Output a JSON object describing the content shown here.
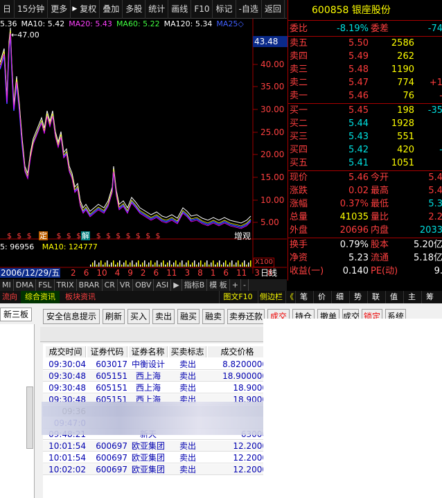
{
  "toolbar": {
    "items": [
      "日",
      "15分钟",
      "更多",
      "复权",
      "叠加",
      "多股",
      "统计",
      "画线",
      "F10",
      "标记",
      "-自选",
      "返回"
    ],
    "arrow": "▶"
  },
  "ma": {
    "first": "5.36",
    "ma10": "MA10: 5.42",
    "ma20": "MA20: 5.43",
    "ma60": "MA60: 5.22",
    "ma120": "MA120: 5.34",
    "ma250": "MA25◇"
  },
  "chart": {
    "peak_label": "47.00",
    "price_box": "43.48",
    "yticks": [
      "40.00",
      "35.00",
      "30.00",
      "25.00",
      "20.00",
      "15.00",
      "10.00",
      "5.00"
    ],
    "mid_labels": [
      "增",
      "观"
    ],
    "vol_label": "5: 96956",
    "vol_ma": "MA10: 124777",
    "x100": "X100",
    "date_label": "2006/12/29/五",
    "date_ticks": [
      "2",
      "6",
      "10",
      "4",
      "9",
      "2",
      "6",
      "11",
      "3",
      "8",
      "1",
      "6",
      "11",
      "3",
      "8"
    ],
    "dayline": "日线",
    "sig_marks": [
      "$",
      "$",
      "$",
      "$",
      "$",
      "$",
      "$",
      "$",
      "$",
      "$",
      "$",
      "$",
      "$",
      "$",
      "$",
      "$"
    ],
    "sig_special": [
      "定",
      "解"
    ]
  },
  "stock": {
    "code": "600858",
    "name": "银座股份"
  },
  "quote": {
    "weibi_label": "委比",
    "weibi": "-8.19%",
    "weicha_label": "委差",
    "weicha": "-74",
    "asks": [
      {
        "label": "卖五",
        "price": "5.50",
        "vol": "2586",
        "chg": ""
      },
      {
        "label": "卖四",
        "price": "5.49",
        "vol": "262",
        "chg": ""
      },
      {
        "label": "卖三",
        "price": "5.48",
        "vol": "1190",
        "chg": ""
      },
      {
        "label": "卖二",
        "price": "5.47",
        "vol": "774",
        "chg": "+1"
      },
      {
        "label": "卖一",
        "price": "5.46",
        "vol": "76",
        "chg": "-"
      }
    ],
    "bids": [
      {
        "label": "买一",
        "price": "5.45",
        "vol": "198",
        "chg": "-35"
      },
      {
        "label": "买二",
        "price": "5.44",
        "vol": "1928",
        "chg": ""
      },
      {
        "label": "买三",
        "price": "5.43",
        "vol": "551",
        "chg": ""
      },
      {
        "label": "买四",
        "price": "5.42",
        "vol": "420",
        "chg": "-"
      },
      {
        "label": "买五",
        "price": "5.41",
        "vol": "1051",
        "chg": ""
      }
    ],
    "stats": [
      {
        "l1": "现价",
        "v1": "5.46",
        "l2": "今开",
        "v2": "5.4"
      },
      {
        "l1": "涨跌",
        "v1": "0.02",
        "l2": "最高",
        "v2": "5.4"
      },
      {
        "l1": "涨幅",
        "v1": "0.37%",
        "l2": "最低",
        "v2": "5.3"
      },
      {
        "l1": "总量",
        "v1": "41035",
        "l2": "量比",
        "v2": "2.2"
      },
      {
        "l1": "外盘",
        "v1": "20696",
        "l2": "内盘",
        "v2": "2033"
      }
    ],
    "extra": [
      {
        "l1": "换手",
        "v1": "0.79%",
        "l2": "股本",
        "v2": "5.20亿"
      },
      {
        "l1": "净资",
        "v1": "5.23",
        "l2": "流通",
        "v2": "5.18亿"
      },
      {
        "l1": "收益(一)",
        "v1": "0.140",
        "l2": "PE(动)",
        "v2": "9."
      }
    ]
  },
  "indtabs": [
    "MI",
    "DMA",
    "FSL",
    "TRIX",
    "BRAR",
    "CR",
    "VR",
    "OBV",
    "ASI",
    "▶",
    "指标B",
    "模 板",
    "+",
    "-"
  ],
  "subtabs": {
    "left": [
      "流向",
      "综合资讯",
      "板块资讯"
    ],
    "right": [
      "图文F10",
      "侧边栏",
      "《",
      "笔",
      "价",
      "细",
      "势",
      "联",
      "值",
      "主",
      "筹"
    ]
  },
  "lower": {
    "left_btn": "新三板",
    "buttons": [
      "安全信息提示",
      "刷新",
      "买入",
      "卖出",
      "融买",
      "融卖",
      "卖券还款",
      "成交",
      "持仓",
      "撤单",
      "成交",
      "锁定",
      "系统"
    ],
    "headers": [
      "成交时间",
      "证券代码",
      "证券名称",
      "买卖标志",
      "成交价格",
      "成交"
    ],
    "rows": [
      {
        "time": "09:30:04",
        "code": "603017",
        "name": "中衡设计",
        "flag": "卖出",
        "price": "8.8200000"
      },
      {
        "time": "09:30:48",
        "code": "605151",
        "name": "西上海",
        "flag": "卖出",
        "price": "18.900000"
      },
      {
        "time": "09:30:48",
        "code": "605151",
        "name": "西上海",
        "flag": "卖出",
        "price": "18.9000"
      },
      {
        "time": "09:30:48",
        "code": "605151",
        "name": "西上海",
        "flag": "卖出",
        "price": "18.9000"
      },
      {
        "time": "09:36",
        "code": "",
        "name": "",
        "flag": "",
        "price": ""
      },
      {
        "time": "09:47:0",
        "code": "",
        "name": "",
        "flag": "",
        "price": ""
      },
      {
        "time": "09:48:21",
        "code": "",
        "name": "新天",
        "flag": "",
        "price": "63000"
      },
      {
        "time": "10:01:54",
        "code": "600697",
        "name": "欧亚集团",
        "flag": "卖出",
        "price": "12.2000"
      },
      {
        "time": "10:01:54",
        "code": "600697",
        "name": "欧亚集团",
        "flag": "卖出",
        "price": "12.2000"
      },
      {
        "time": "10:02:02",
        "code": "600697",
        "name": "欧亚集团",
        "flag": "卖出",
        "price": "12.2000"
      }
    ]
  },
  "colors": {
    "up": "#ff3c3c",
    "down": "#00e0e0",
    "yellow": "#ffff00",
    "frame": "#a00000"
  }
}
